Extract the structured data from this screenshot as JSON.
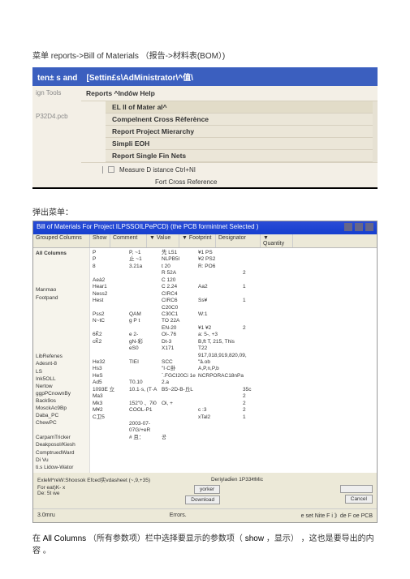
{
  "intro": {
    "prefix": "菜单  ",
    "path": "reports->Bill of Materials",
    "suffix": "（报告->材料表(BOM）)"
  },
  "menubar": {
    "left": "ten± s and",
    "right": "[Settin£s\\AdMinistrator\\^值\\"
  },
  "menu": {
    "sidebar_item1": "ign Tools",
    "sidebar_item2": "P32D4.pcb",
    "reports_header": "Reports ^Indó̇w Help",
    "items": [
      "EL ll of Mater al^",
      "Compelnent Cross Rèferènce",
      "Report Project Mierarchy",
      "Simpli EOH",
      "Report Single Fin Nets"
    ],
    "lower1": "Measure D istance Ctrl+NI",
    "lower2": "Fort Cross Reference"
  },
  "popup_label": "弹出菜单：",
  "bom": {
    "title": "Bill of Materials For Project ILPSSOILPePCD) (the PCB formintnet Selected )",
    "headers": {
      "h1": "Grouped Columns",
      "h2": "Show",
      "h3": "Comment",
      "h4": "▼ Value",
      "h5": "▼ Footprint",
      "h6": "Designator",
      "h7": "▼ Quantity"
    },
    "allcols_title": "All Columns",
    "allcols_lines": [
      "",
      "",
      "",
      "",
      "Manmao",
      "Footpand",
      "",
      "",
      "",
      "",
      "",
      "",
      "",
      "LibRefenes",
      "Adesnt-8",
      "LS",
      "Ink5OLL",
      "Nertow",
      "ggpPCnownBy",
      "Back9os",
      "MosckAc9Bp",
      "Daba_PC",
      "ChewPC",
      "",
      "CarpamTricker",
      "Deakposol/Kiesh",
      "ComptruedWard",
      "Di Vu",
      "ti.s Lidow-Wator"
    ],
    "rows": [
      {
        "c1": "P",
        "c2": "P, ~1",
        "c3": "先 L51",
        "c4": "¥1 PS",
        "c5": ""
      },
      {
        "c1": "P",
        "c2": "止 ~1",
        "c3": "NLPB5l",
        "c4": "¥2 PS2",
        "c5": ""
      },
      {
        "c1": "8",
        "c2": "3.21a",
        "c3": "t 20",
        "c4": "R: PO6",
        "c5": ""
      },
      {
        "c1": "",
        "c2": "",
        "c3": "R 52A",
        "c4": "",
        "c5": "2"
      },
      {
        "c1": "Aeà2",
        "c2": "",
        "c3": "C 120",
        "c4": "",
        "c5": ""
      },
      {
        "c1": "Hear1",
        "c2": "",
        "c3": "C 2.24",
        "c4": "Aa2",
        "c5": "1"
      },
      {
        "c1": "Ness2",
        "c2": "",
        "c3": "CIRC4",
        "c4": "",
        "c5": ""
      },
      {
        "c1": "Hest",
        "c2": "",
        "c3": "CIRC6",
        "c4": "Ss¥",
        "c5": "1"
      },
      {
        "c1": "",
        "c2": "",
        "c3": "C20C0",
        "c4": "",
        "c5": ""
      },
      {
        "c1": "Pss2",
        "c2": "QAM",
        "c3": "C30C1",
        "c4": "W:1",
        "c5": ""
      },
      {
        "c1": "N~tC",
        "c2": "g P t",
        "c3": "TO 22A",
        "c4": "",
        "c5": ""
      },
      {
        "c1": "",
        "c2": "",
        "c3": "EN-20",
        "c4": "¥1 ¥2",
        "c5": "2"
      },
      {
        "c1": "6K̃2",
        "c2": "e 2-",
        "c3": "OI-.76",
        "c4": "a: 5-, +3",
        "c5": ""
      },
      {
        "c1": "cK̃2",
        "c2": "gN-彩",
        "c3": "Dt-3",
        "c4": "B,ft T, 215, This",
        "c5": ""
      },
      {
        "c1": "",
        "c2": "eS0",
        "c3": "X171",
        "c4": "T22",
        "c5": ""
      },
      {
        "c1": "",
        "c2": "",
        "c3": "",
        "c4": "917,018,919,820,09,",
        "c5": ""
      },
      {
        "c1": "He32",
        "c2": "TIEI",
        "c3": "SCC",
        "c4": "\"â.ob",
        "c5": ""
      },
      {
        "c1": "Hs3",
        "c2": "",
        "c3": "\"I·C卦",
        "c4": "A,P,n,P,b",
        "c5": ""
      },
      {
        "c1": "HeS",
        "c2": "",
        "c3": "`.FGCI20Ci 1e",
        "c4": "NCRPORAC18nPa",
        "c5": ""
      },
      {
        "c1": "Ad5",
        "c2": "T0.10",
        "c3": "2.a",
        "c4": "",
        "c5": ""
      },
      {
        "c1": "1093E 立",
        "c2": "10.1·s, (T·A",
        "c3": "B5~2D-B-丘L",
        "c4": "",
        "c5": "35c"
      },
      {
        "c1": "Ma3",
        "c2": "",
        "c3": "",
        "c4": "",
        "c5": "2"
      },
      {
        "c1": "Mk3",
        "c2": "152\"0 、7i0",
        "c3": "Oi, +",
        "c4": "",
        "c5": "2"
      },
      {
        "c1": "M¥2",
        "c2": "COOL-P1",
        "c3": "",
        "c4": "c :3",
        "c5": "2"
      },
      {
        "c1": "C卫5",
        "c2": "",
        "c3": "",
        "c4": "xTal2",
        "c5": "1"
      },
      {
        "c1": "",
        "c2": "2003-07-07G/+eR",
        "c3": "",
        "c4": "",
        "c5": ""
      },
      {
        "c1": "",
        "c2": "# 且：",
        "c3": "공",
        "c4": "",
        "c5": ""
      }
    ],
    "export_label": "ExleM*reW:Shoosok Efced实vdasheet (~,9,+35)",
    "template_label": "Deriyladi̇en 1P33शMic",
    "opt1": "For eat)K- x",
    "opt2": "De: 5t we",
    "footer_left": "3.0mru",
    "footer_left2": "Errors.",
    "footer_right": "e set Nite F i 》de F oe PCB",
    "btn_download": "Download",
    "btn_cancel": "Cancel",
    "btn_yorker": "yorker"
  },
  "description": {
    "t1": "在 ",
    "kw1": "All Columns",
    "t2": " （所有参数项）栏中选择要显示的参数项（ ",
    "kw2": "show",
    "t3": "，显示） ，这也是要导出的内容 。"
  }
}
